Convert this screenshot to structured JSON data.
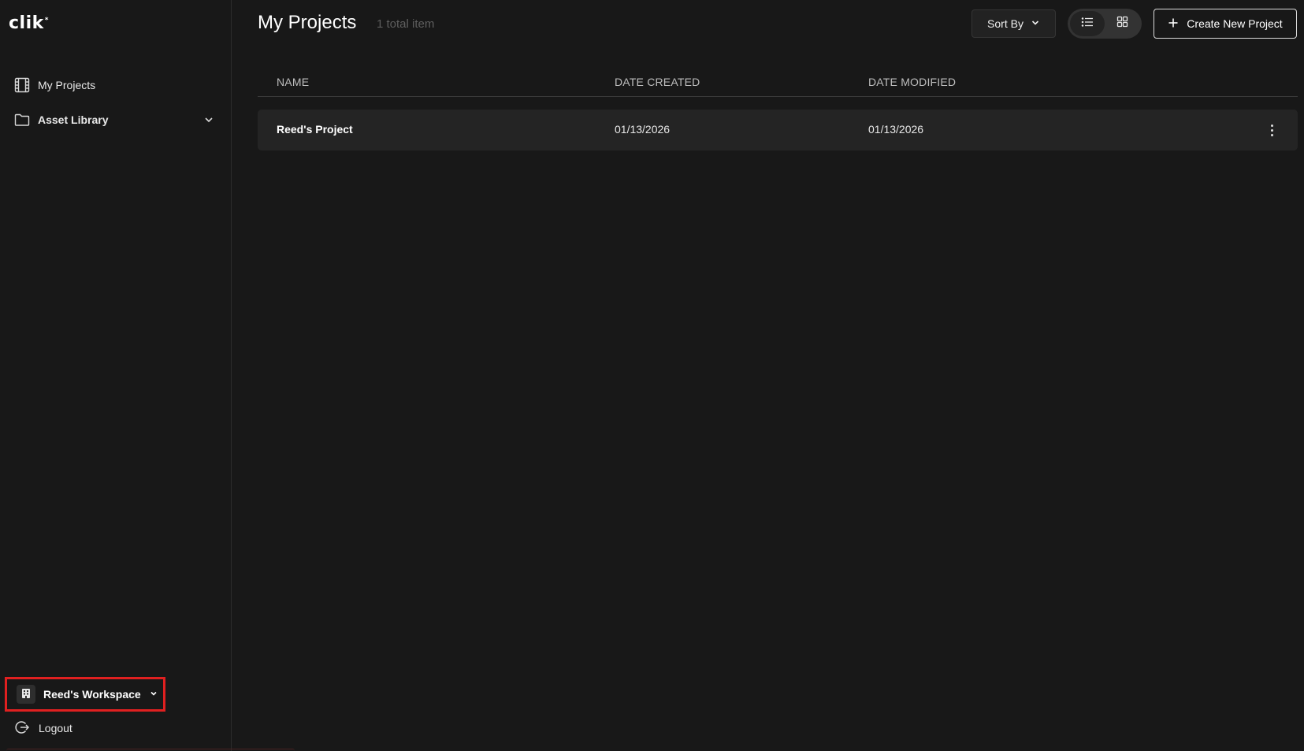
{
  "app": {
    "logo_text": "clik",
    "logo_mark": "*"
  },
  "sidebar": {
    "items": [
      {
        "label": "My Projects",
        "icon": "film-icon"
      },
      {
        "label": "Asset Library",
        "icon": "folder-icon"
      }
    ],
    "workspace_label": "Reed's Workspace",
    "logout_label": "Logout"
  },
  "header": {
    "title": "My Projects",
    "count": "1 total item",
    "sort_label": "Sort By",
    "create_label": "Create New Project",
    "view_mode": "list"
  },
  "table": {
    "columns": [
      "NAME",
      "DATE CREATED",
      "DATE MODIFIED"
    ],
    "rows": [
      {
        "name": "Reed's Project",
        "created": "01/13/2026",
        "modified": "01/13/2026"
      }
    ]
  },
  "colors": {
    "background": "#181818",
    "row": "#242424",
    "highlight": "#e02020"
  }
}
